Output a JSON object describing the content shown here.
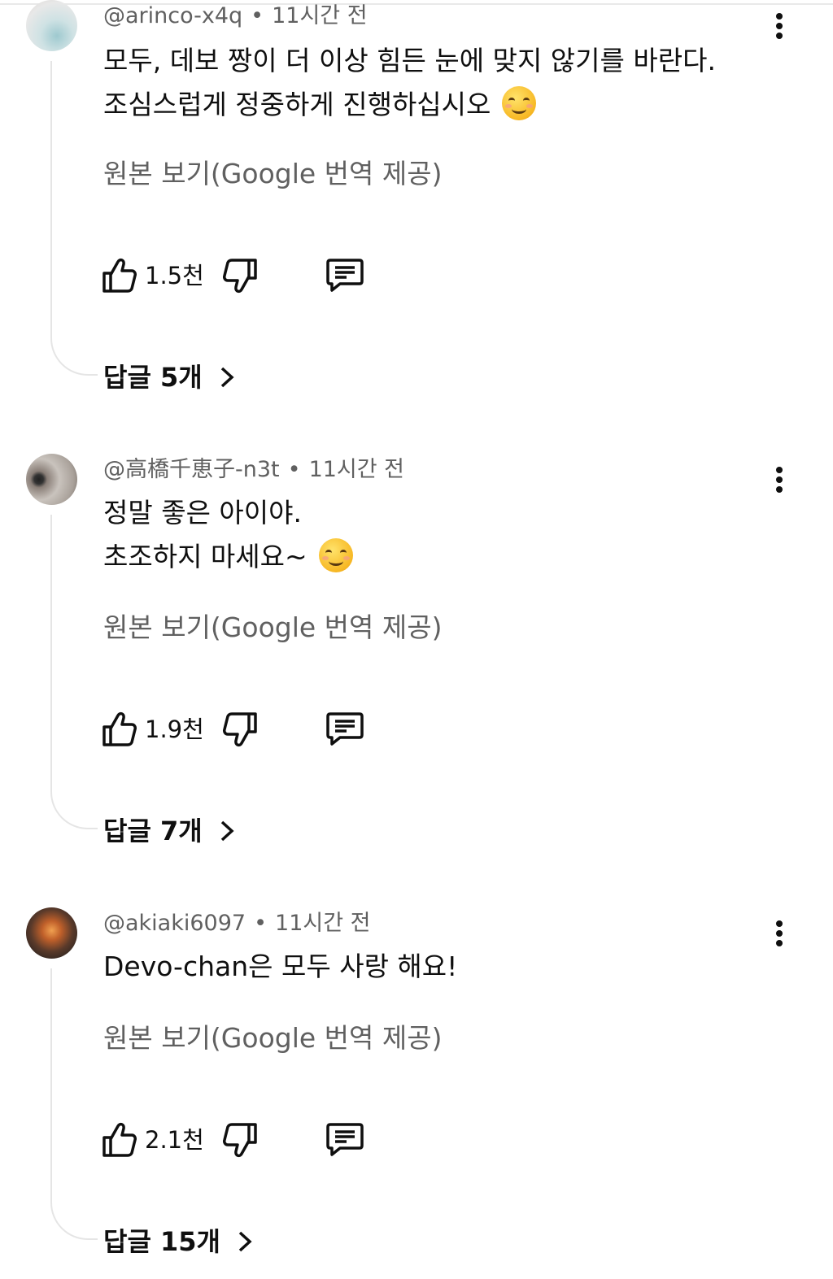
{
  "comments": [
    {
      "handle": "@arinco-x4q",
      "time": "11시간 전",
      "lines": [
        "모두, 데보 짱이 더 이상 힘든 눈에 맞지 않기를 바란다.",
        "조심스럽게 정중하게 진행하십시오"
      ],
      "emoji": "smiling-face-emoji",
      "translate_label": "원본 보기(Google 번역 제공)",
      "likes": "1.5천",
      "replies_label": "답글 5개"
    },
    {
      "handle": "@高橋千恵子-n3t",
      "time": "11시간 전",
      "lines": [
        "정말 좋은 아이야.",
        "초조하지 마세요~"
      ],
      "emoji": "smiling-face-emoji",
      "translate_label": "원본 보기(Google 번역 제공)",
      "likes": "1.9천",
      "replies_label": "답글 7개"
    },
    {
      "handle": "@akiaki6097",
      "time": "11시간 전",
      "lines": [
        "Devo-chan은 모두 사랑 해요!"
      ],
      "emoji": "",
      "translate_label": "원본 보기(Google 번역 제공)",
      "likes": "2.1천",
      "replies_label": "답글 15개"
    }
  ],
  "separator": "•",
  "colors": {
    "text": "#0f0f0f",
    "secondary": "#606060",
    "thread_line": "#e5e5e5"
  },
  "icons": [
    "thumbs-up-icon",
    "thumbs-down-icon",
    "reply-comment-icon",
    "more-vert-icon",
    "chevron-right-icon"
  ]
}
